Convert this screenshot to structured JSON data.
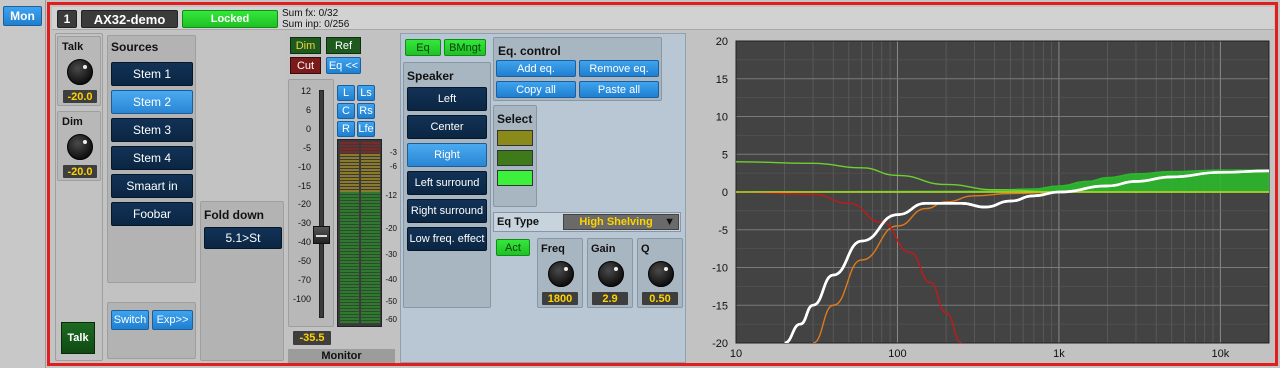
{
  "left_strip": {
    "mon_label": "Mon"
  },
  "header": {
    "channel_number": "1",
    "device_name": "AX32-demo",
    "lock_status": "Locked",
    "sum_fx": "Sum fx: 0/32",
    "sum_inp": "Sum inp: 0/256"
  },
  "talk_dim": {
    "talk_label": "Talk",
    "talk_value": "-20.0",
    "dim_label": "Dim",
    "dim_value": "-20.0",
    "talk_button": "Talk"
  },
  "sources": {
    "title": "Sources",
    "items": [
      "Stem 1",
      "Stem 2",
      "Stem 3",
      "Stem 4",
      "Smaart in",
      "Foobar"
    ],
    "selected_index": 1,
    "switch_label": "Switch",
    "exp_label": "Exp>>"
  },
  "fold_down": {
    "title": "Fold down",
    "value": "5.1>St"
  },
  "monitor": {
    "dim_label": "Dim",
    "ref_label": "Ref",
    "cut_label": "Cut",
    "eq_label": "Eq <<",
    "fader_scale": [
      "12",
      "6",
      "0",
      "-5",
      "-10",
      "-15",
      "-20",
      "-30",
      "-40",
      "-50",
      "-70",
      "-100"
    ],
    "fader_value": "-35.5",
    "fader_level_db": -35.5,
    "speaker_buttons": [
      "L",
      "Ls",
      "C",
      "Rs",
      "R",
      "Lfe"
    ],
    "meter_scale": [
      "-3",
      "-6",
      "-12",
      "-20",
      "-30",
      "-40",
      "-50",
      "-60"
    ],
    "title": "Monitor"
  },
  "eq_panel": {
    "eq_tab": "Eq",
    "bmngt_tab": "BMngt",
    "speaker_title": "Speaker",
    "speakers": [
      "Left",
      "Center",
      "Right",
      "Left surround",
      "Right surround",
      "Low freq. effect"
    ],
    "selected_speaker_index": 2,
    "eq_control_title": "Eq. control",
    "add_eq": "Add eq.",
    "remove_eq": "Remove eq.",
    "copy_all": "Copy all",
    "paste_all": "Paste all",
    "select_title": "Select",
    "select_colors": [
      "#8a8a1a",
      "#3f7a1a",
      "#3cf03c"
    ],
    "eq_type_label": "Eq Type",
    "eq_type_value": "High Shelving",
    "act_label": "Act",
    "freq_label": "Freq",
    "freq_value": "1800",
    "gain_label": "Gain",
    "gain_value": "2.9",
    "q_label": "Q",
    "q_value": "0.50"
  },
  "chart_data": {
    "type": "line",
    "xscale": "log",
    "xlim": [
      10,
      20000
    ],
    "ylim": [
      -20,
      20
    ],
    "y_ticks": [
      "20",
      "15",
      "10",
      "5",
      "0",
      "-5",
      "-10",
      "-15",
      "-20"
    ],
    "x_ticks": [
      "10",
      "100",
      "1k",
      "10k"
    ],
    "grid": true,
    "series": [
      {
        "color": "#ffffff",
        "x": [
          20,
          25,
          30,
          40,
          60,
          100,
          150,
          250,
          350,
          500,
          700,
          1000,
          2000,
          3000,
          5000,
          10000,
          20000
        ],
        "y": [
          -20,
          -17.5,
          -15,
          -11,
          -6.5,
          -3,
          -1.5,
          -1.5,
          -2,
          -1.2,
          -0.5,
          0,
          0.8,
          1.4,
          2,
          2.6,
          2.8
        ]
      },
      {
        "color": "#e07b1a",
        "x": [
          30,
          40,
          60,
          100,
          150,
          200,
          300,
          500,
          1000
        ],
        "y": [
          -20,
          -15,
          -9,
          -4.5,
          -2.2,
          -1.3,
          -0.5,
          -0.2,
          0
        ]
      },
      {
        "color": "#c51818",
        "x": [
          10,
          30,
          50,
          80,
          120,
          160,
          200,
          250
        ],
        "y": [
          0,
          -0.3,
          -1.5,
          -4,
          -8,
          -12,
          -16,
          -20
        ]
      },
      {
        "color": "#6fcf2e",
        "x": [
          10,
          30,
          60,
          100,
          200,
          400,
          1000,
          2000,
          5000,
          20000
        ],
        "y": [
          4,
          3.8,
          3.2,
          2.2,
          1,
          0.3,
          0,
          0,
          0,
          0
        ]
      },
      {
        "color": "#b7d02a",
        "x": [
          10,
          100,
          500,
          1000,
          20000
        ],
        "y": [
          0,
          0,
          0,
          0,
          0
        ]
      },
      {
        "color": "#2cb82c",
        "fill": true,
        "x": [
          10,
          300,
          700,
          1000,
          1500,
          2000,
          3000,
          5000,
          10000,
          20000
        ],
        "y": [
          0,
          0.1,
          0.4,
          0.8,
          1.4,
          1.9,
          2.4,
          2.7,
          2.9,
          2.9
        ]
      }
    ]
  }
}
